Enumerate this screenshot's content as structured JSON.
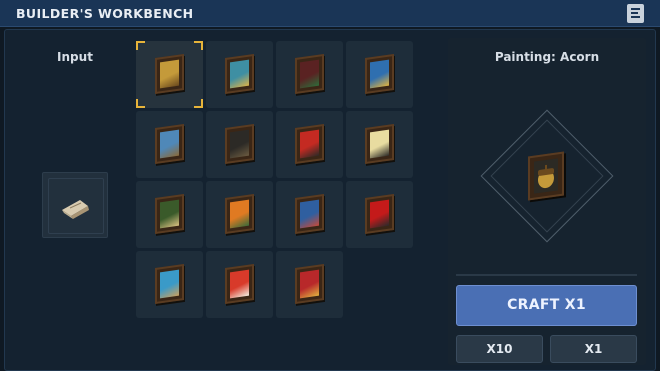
{
  "window": {
    "title": "BUILDER'S WORKBENCH",
    "menu_icon": "list-icon"
  },
  "input": {
    "label": "Input",
    "item_icon": "scroll-paper-icon"
  },
  "recipes": [
    {
      "name": "Acorn",
      "icon": "painting-acorn-icon",
      "colors": [
        "#c49a3a",
        "#6b4a1e"
      ],
      "selected": true
    },
    {
      "name": "",
      "icon": "painting-icon",
      "colors": [
        "#3e8fa3",
        "#d9b24a"
      ]
    },
    {
      "name": "",
      "icon": "painting-icon",
      "colors": [
        "#5a2222",
        "#2f6b3a"
      ]
    },
    {
      "name": "",
      "icon": "painting-icon",
      "colors": [
        "#2f6fb0",
        "#e0b340"
      ]
    },
    {
      "name": "",
      "icon": "painting-icon",
      "colors": [
        "#4f88b8",
        "#8a6a3a"
      ]
    },
    {
      "name": "",
      "icon": "painting-icon",
      "colors": [
        "#2c2a26",
        "#6a5a40"
      ]
    },
    {
      "name": "",
      "icon": "painting-icon",
      "colors": [
        "#c42a22",
        "#2c2a26"
      ]
    },
    {
      "name": "",
      "icon": "painting-icon",
      "colors": [
        "#e8dca0",
        "#2c2a26"
      ]
    },
    {
      "name": "",
      "icon": "painting-icon",
      "colors": [
        "#3a5a2a",
        "#d8c080"
      ]
    },
    {
      "name": "",
      "icon": "painting-icon",
      "colors": [
        "#e07a22",
        "#3a6a3a"
      ]
    },
    {
      "name": "",
      "icon": "painting-icon",
      "colors": [
        "#2f5fa0",
        "#c44a3a"
      ]
    },
    {
      "name": "",
      "icon": "painting-icon",
      "colors": [
        "#c41a1a",
        "#2a2a2a"
      ]
    },
    {
      "name": "",
      "icon": "painting-icon",
      "colors": [
        "#3a9ac8",
        "#c8a060"
      ]
    },
    {
      "name": "",
      "icon": "painting-icon",
      "colors": [
        "#d83a2a",
        "#f2eee0"
      ]
    },
    {
      "name": "",
      "icon": "painting-icon",
      "colors": [
        "#b8282a",
        "#e0b040"
      ]
    }
  ],
  "preview": {
    "title": "Painting: Acorn",
    "icon": "painting-acorn-icon"
  },
  "buttons": {
    "craft": "CRAFT X1",
    "x10": "X10",
    "x1": "X1"
  },
  "colors": {
    "accent": "#4a6fb4",
    "selection": "#e7b43a",
    "titlebar": "#1a3556"
  }
}
